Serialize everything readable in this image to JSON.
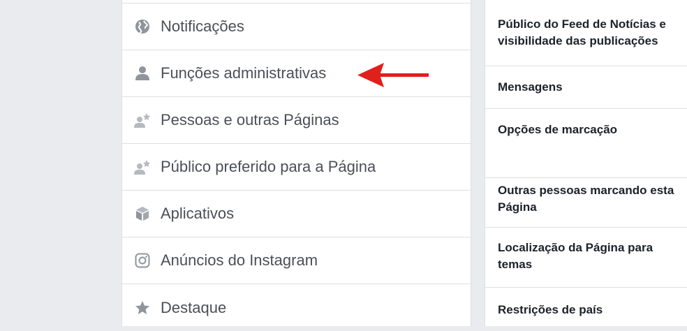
{
  "settings_menu": {
    "items": [
      {
        "label": "Notificações",
        "icon": "globe-icon"
      },
      {
        "label": "Funções administrativas",
        "icon": "person-icon"
      },
      {
        "label": "Pessoas e outras Páginas",
        "icon": "person-star-icon"
      },
      {
        "label": "Público preferido para a Página",
        "icon": "person-star-icon"
      },
      {
        "label": "Aplicativos",
        "icon": "cube-icon"
      },
      {
        "label": "Anúncios do Instagram",
        "icon": "instagram-icon"
      },
      {
        "label": "Destaque",
        "icon": "star-icon"
      }
    ]
  },
  "general_settings": {
    "items": [
      {
        "lines": [
          "Público do Feed de Notícias e",
          "visibilidade das publicações"
        ]
      },
      {
        "lines": [
          "Mensagens"
        ]
      },
      {
        "lines": [
          "Opções de marcação"
        ]
      },
      {
        "lines": [
          "Outras pessoas marcando esta",
          "Página"
        ]
      },
      {
        "lines": [
          "Localização da Página para",
          "temas"
        ]
      },
      {
        "lines": [
          "Restrições de país"
        ]
      }
    ]
  },
  "annotation": {
    "color": "#e0201b",
    "points_to": "Funções administrativas"
  },
  "colors": {
    "background": "#e9ebee",
    "icon": "#90949c",
    "text": "#4b4f56",
    "heading": "#1d2129"
  }
}
